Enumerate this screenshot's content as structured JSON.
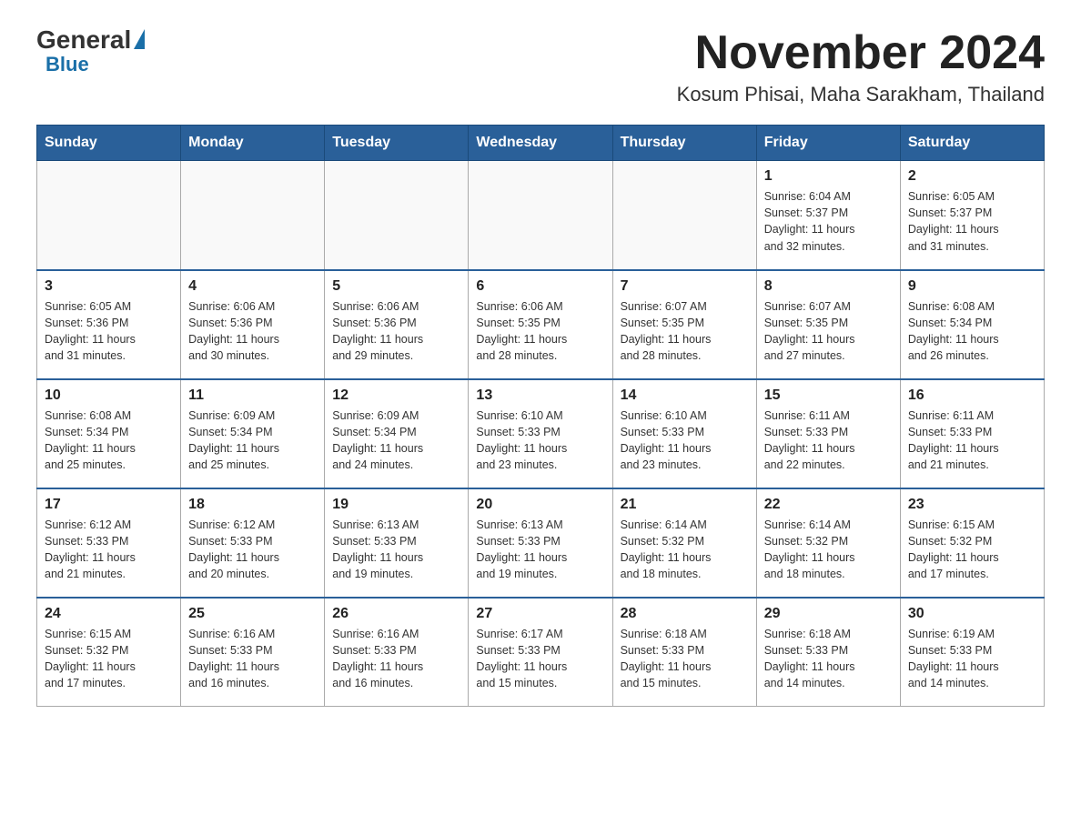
{
  "logo": {
    "general": "General",
    "blue": "Blue",
    "triangle": "▲"
  },
  "header": {
    "month": "November 2024",
    "location": "Kosum Phisai, Maha Sarakham, Thailand"
  },
  "weekdays": [
    "Sunday",
    "Monday",
    "Tuesday",
    "Wednesday",
    "Thursday",
    "Friday",
    "Saturday"
  ],
  "weeks": [
    [
      {
        "day": "",
        "info": ""
      },
      {
        "day": "",
        "info": ""
      },
      {
        "day": "",
        "info": ""
      },
      {
        "day": "",
        "info": ""
      },
      {
        "day": "",
        "info": ""
      },
      {
        "day": "1",
        "info": "Sunrise: 6:04 AM\nSunset: 5:37 PM\nDaylight: 11 hours\nand 32 minutes."
      },
      {
        "day": "2",
        "info": "Sunrise: 6:05 AM\nSunset: 5:37 PM\nDaylight: 11 hours\nand 31 minutes."
      }
    ],
    [
      {
        "day": "3",
        "info": "Sunrise: 6:05 AM\nSunset: 5:36 PM\nDaylight: 11 hours\nand 31 minutes."
      },
      {
        "day": "4",
        "info": "Sunrise: 6:06 AM\nSunset: 5:36 PM\nDaylight: 11 hours\nand 30 minutes."
      },
      {
        "day": "5",
        "info": "Sunrise: 6:06 AM\nSunset: 5:36 PM\nDaylight: 11 hours\nand 29 minutes."
      },
      {
        "day": "6",
        "info": "Sunrise: 6:06 AM\nSunset: 5:35 PM\nDaylight: 11 hours\nand 28 minutes."
      },
      {
        "day": "7",
        "info": "Sunrise: 6:07 AM\nSunset: 5:35 PM\nDaylight: 11 hours\nand 28 minutes."
      },
      {
        "day": "8",
        "info": "Sunrise: 6:07 AM\nSunset: 5:35 PM\nDaylight: 11 hours\nand 27 minutes."
      },
      {
        "day": "9",
        "info": "Sunrise: 6:08 AM\nSunset: 5:34 PM\nDaylight: 11 hours\nand 26 minutes."
      }
    ],
    [
      {
        "day": "10",
        "info": "Sunrise: 6:08 AM\nSunset: 5:34 PM\nDaylight: 11 hours\nand 25 minutes."
      },
      {
        "day": "11",
        "info": "Sunrise: 6:09 AM\nSunset: 5:34 PM\nDaylight: 11 hours\nand 25 minutes."
      },
      {
        "day": "12",
        "info": "Sunrise: 6:09 AM\nSunset: 5:34 PM\nDaylight: 11 hours\nand 24 minutes."
      },
      {
        "day": "13",
        "info": "Sunrise: 6:10 AM\nSunset: 5:33 PM\nDaylight: 11 hours\nand 23 minutes."
      },
      {
        "day": "14",
        "info": "Sunrise: 6:10 AM\nSunset: 5:33 PM\nDaylight: 11 hours\nand 23 minutes."
      },
      {
        "day": "15",
        "info": "Sunrise: 6:11 AM\nSunset: 5:33 PM\nDaylight: 11 hours\nand 22 minutes."
      },
      {
        "day": "16",
        "info": "Sunrise: 6:11 AM\nSunset: 5:33 PM\nDaylight: 11 hours\nand 21 minutes."
      }
    ],
    [
      {
        "day": "17",
        "info": "Sunrise: 6:12 AM\nSunset: 5:33 PM\nDaylight: 11 hours\nand 21 minutes."
      },
      {
        "day": "18",
        "info": "Sunrise: 6:12 AM\nSunset: 5:33 PM\nDaylight: 11 hours\nand 20 minutes."
      },
      {
        "day": "19",
        "info": "Sunrise: 6:13 AM\nSunset: 5:33 PM\nDaylight: 11 hours\nand 19 minutes."
      },
      {
        "day": "20",
        "info": "Sunrise: 6:13 AM\nSunset: 5:33 PM\nDaylight: 11 hours\nand 19 minutes."
      },
      {
        "day": "21",
        "info": "Sunrise: 6:14 AM\nSunset: 5:32 PM\nDaylight: 11 hours\nand 18 minutes."
      },
      {
        "day": "22",
        "info": "Sunrise: 6:14 AM\nSunset: 5:32 PM\nDaylight: 11 hours\nand 18 minutes."
      },
      {
        "day": "23",
        "info": "Sunrise: 6:15 AM\nSunset: 5:32 PM\nDaylight: 11 hours\nand 17 minutes."
      }
    ],
    [
      {
        "day": "24",
        "info": "Sunrise: 6:15 AM\nSunset: 5:32 PM\nDaylight: 11 hours\nand 17 minutes."
      },
      {
        "day": "25",
        "info": "Sunrise: 6:16 AM\nSunset: 5:33 PM\nDaylight: 11 hours\nand 16 minutes."
      },
      {
        "day": "26",
        "info": "Sunrise: 6:16 AM\nSunset: 5:33 PM\nDaylight: 11 hours\nand 16 minutes."
      },
      {
        "day": "27",
        "info": "Sunrise: 6:17 AM\nSunset: 5:33 PM\nDaylight: 11 hours\nand 15 minutes."
      },
      {
        "day": "28",
        "info": "Sunrise: 6:18 AM\nSunset: 5:33 PM\nDaylight: 11 hours\nand 15 minutes."
      },
      {
        "day": "29",
        "info": "Sunrise: 6:18 AM\nSunset: 5:33 PM\nDaylight: 11 hours\nand 14 minutes."
      },
      {
        "day": "30",
        "info": "Sunrise: 6:19 AM\nSunset: 5:33 PM\nDaylight: 11 hours\nand 14 minutes."
      }
    ]
  ]
}
